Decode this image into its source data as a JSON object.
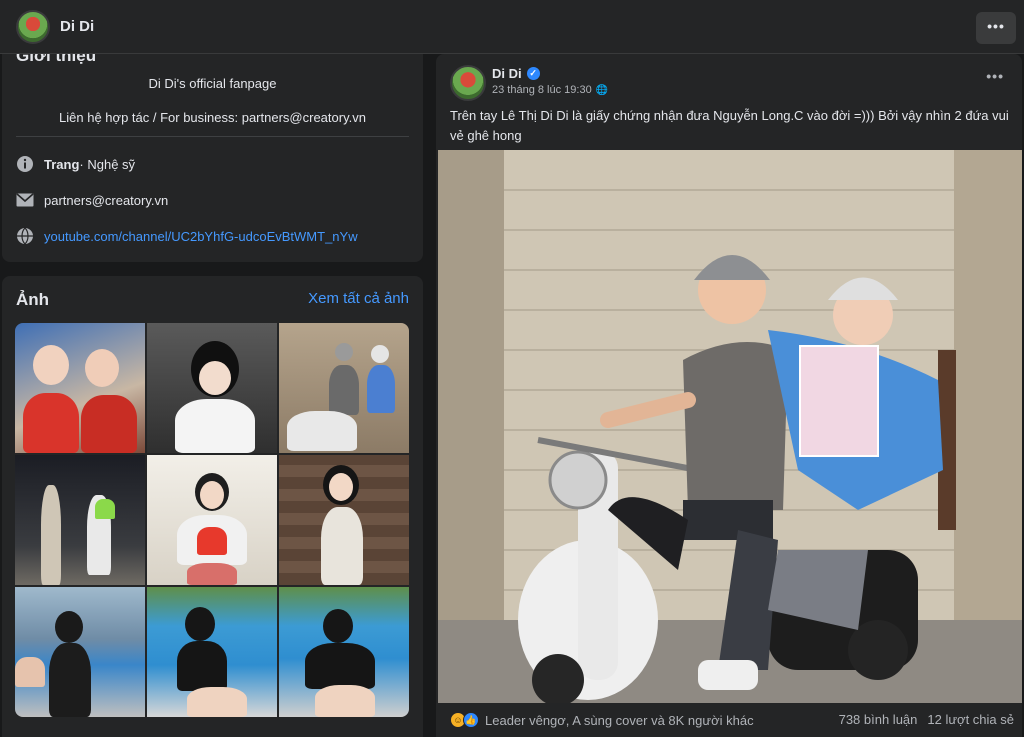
{
  "header": {
    "page_name": "Di Di",
    "more_label": "•••"
  },
  "intro": {
    "title": "Giới thiệu",
    "bio_line1": "Di Di's official fanpage",
    "bio_line2": "Liên hệ hợp tác / For business: partners@creatory.vn",
    "category_prefix": "Trang",
    "category_text": " · Nghệ sỹ",
    "email": "partners@creatory.vn",
    "website": "youtube.com/channel/UC2bYhfG-udcoEvBtWMT_nYw"
  },
  "photos": {
    "title": "Ảnh",
    "see_all": "Xem tất cả ảnh"
  },
  "post": {
    "author": "Di Di",
    "timestamp": "23 tháng 8 lúc 19:30",
    "globe_icon": "🌐",
    "more_label": "•••",
    "text": "Trên tay Lê Thị Di Di là giấy chứng nhận đưa Nguyễn Long.C vào đời =))) Bởi vậy nhìn 2 đứa vui vẻ ghê hong",
    "reactions_text": "Leader vêngơ, A sùng cover và 8K người khác",
    "comments": "738 bình luận",
    "shares": "12 lượt chia sẻ"
  },
  "colors": {
    "background": "#18191a",
    "card": "#242526",
    "link": "#4599ff",
    "verified": "#2d88ff"
  },
  "icons": [
    "info-icon",
    "mail-icon",
    "globe-icon",
    "verified-icon",
    "haha-reaction-icon",
    "like-reaction-icon"
  ]
}
